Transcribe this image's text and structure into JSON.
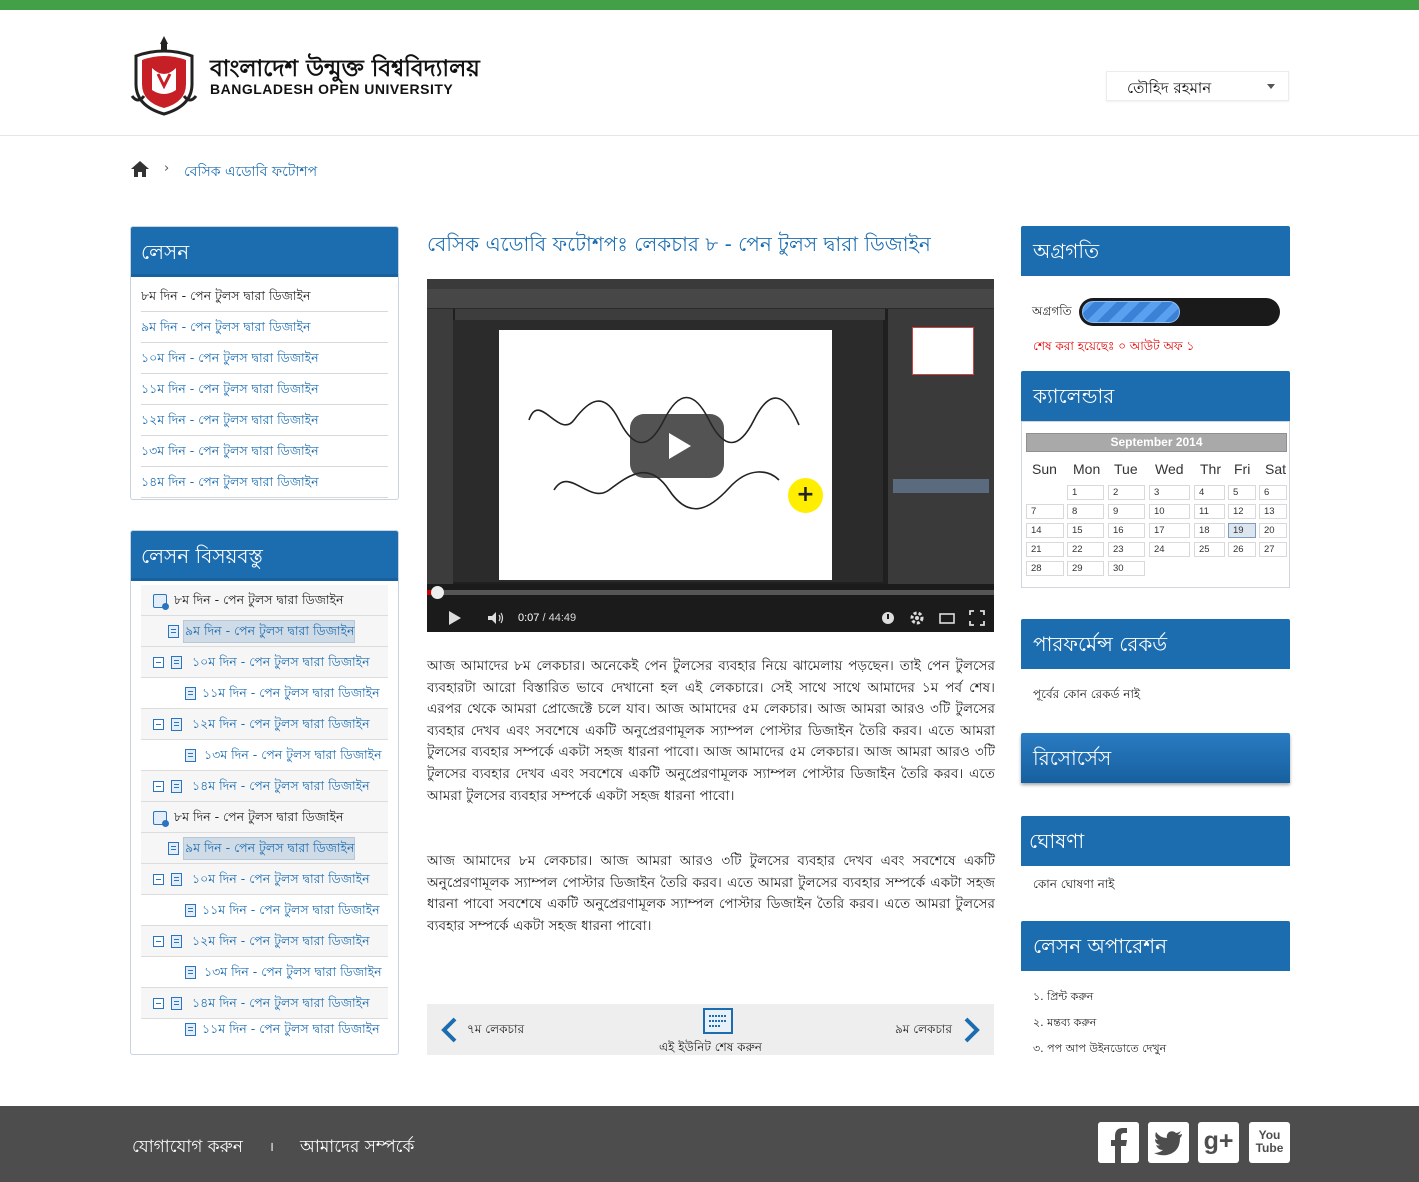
{
  "brand": {
    "name_bn": "বাংলাদেশ উন্মুক্ত বিশ্ববিদ্যালয়",
    "name_en": "BANGLADESH OPEN UNIVERSITY"
  },
  "user": {
    "name": "তৌহিদ রহমান"
  },
  "breadcrumb": {
    "current": "বেসিক এডোবি ফটোশপ"
  },
  "lesson_panel": {
    "title": "লেসন",
    "items": [
      "৮ম দিন - পেন টুলস দ্বারা ডিজাইন",
      "৯ম দিন - পেন টুলস দ্বারা ডিজাইন",
      "১০ম দিন - পেন টুলস দ্বারা ডিজাইন",
      "১১ম দিন - পেন টুলস দ্বারা ডিজাইন",
      "১২ম দিন - পেন টুলস দ্বারা ডিজাইন",
      "১৩ম দিন - পেন টুলস দ্বারা ডিজাইন",
      "১৪ম দিন - পেন টুলস দ্বারা ডিজাইন"
    ]
  },
  "content_panel": {
    "title": "লেসন বিসয়বস্তু",
    "tree": [
      "৮ম দিন - পেন টুলস দ্বারা ডিজাইন",
      "৯ম দিন - পেন টুলস দ্বারা ডিজাইন",
      "১০ম দিন - পেন টুলস দ্বারা ডিজাইন",
      "১১ম দিন - পেন টুলস দ্বারা ডিজাইন",
      "১২ম দিন - পেন টুলস দ্বারা ডিজাইন",
      "১৩ম দিন - পেন টুলস দ্বারা ডিজাইন",
      "১৪ম দিন - পেন টুলস দ্বারা ডিজাইন",
      "৮ম দিন - পেন টুলস দ্বারা ডিজাইন",
      "৯ম দিন - পেন টুলস দ্বারা ডিজাইন",
      "১০ম দিন - পেন টুলস দ্বারা ডিজাইন",
      "১১ম দিন - পেন টুলস দ্বারা ডিজাইন",
      "১২ম দিন - পেন টুলস দ্বারা ডিজাইন",
      "১৩ম দিন - পেন টুলস দ্বারা ডিজাইন",
      "১৪ম দিন - পেন টুলস দ্বারা ডিজাইন",
      "১১ম দিন - পেন টুলস দ্বারা ডিজাইন"
    ]
  },
  "main": {
    "title": "বেসিক এডোবি ফটোশপঃ লেকচার  ৮ - পেন টুলস দ্বারা ডিজাইন",
    "video": {
      "current_time": "0:07",
      "duration": "/ 44:49"
    },
    "paragraphs": [
      "আজ আমাদের ৮ম লেকচার। অনেকেই পেন টুলসের ব্যবহার নিয়ে ঝামেলায় পড়ছেন। তাই পেন টুলসের ব্যবহারটা আরো বিস্তারিত ভাবে দেখানো হল এই লেকচারে। সেই সাথে সাথে আমাদের ১ম পর্ব শেষ। এরপর থেকে আমরা প্রোজেক্টে চলে যাব। আজ আমাদের ৫ম লেকচার। আজ আমরা আরও ৩টি টুলসের ব্যবহার দেখব এবং সবশেষে একটি অনুপ্রেরণামূলক স্যাম্পল পোস্টার ডিজাইন তৈরি করব। এতে আমরা টুলসের ব্যবহার সম্পর্কে একটা সহজ ধারনা পাবো। আজ আমাদের ৫ম লেকচার। আজ আমরা আরও ৩টি টুলসের ব্যবহার দেখব এবং সবশেষে একটি অনুপ্রেরণামূলক স্যাম্পল পোস্টার ডিজাইন তৈরি করব। এতে আমরা টুলসের ব্যবহার সম্পর্কে একটা সহজ ধারনা পাবো।",
      "আজ আমাদের ৮ম লেকচার। আজ আমরা আরও ৩টি টুলসের ব্যবহার দেখব এবং সবশেষে একটি অনুপ্রেরণামূলক স্যাম্পল পোস্টার ডিজাইন তৈরি করব। এতে আমরা টুলসের ব্যবহার সম্পর্কে একটা সহজ ধারনা পাবো সবশেষে একটি অনুপ্রেরণামূলক স্যাম্পল পোস্টার ডিজাইন তৈরি করব। এতে আমরা টুলসের ব্যবহার সম্পর্কে একটা সহজ ধারনা পাবো।"
    ],
    "pager": {
      "prev": "৭ম লেকচার",
      "next": "৯ম লেকচার",
      "finish": "এই ইউনিট শেষ করুন"
    }
  },
  "progress_panel": {
    "title": "অগ্রগতি",
    "label": "অগ্রগতি",
    "fraction": 0.5,
    "done_text": "শেষ করা হয়েছেঃ ০ আউট অফ ১"
  },
  "calendar": {
    "title": "ক্যালেন্ডার",
    "month": "September 2014",
    "weekdays": [
      "Sun",
      "Mon",
      "Tue",
      "Wed",
      "Thr",
      "Fri",
      "Sat"
    ],
    "today": "19",
    "weeks": [
      [
        "",
        "1",
        "2",
        "3",
        "4",
        "5",
        "6"
      ],
      [
        "7",
        "8",
        "9",
        "10",
        "11",
        "12",
        "13"
      ],
      [
        "14",
        "15",
        "16",
        "17",
        "18",
        "19",
        "20"
      ],
      [
        "21",
        "22",
        "23",
        "24",
        "25",
        "26",
        "27"
      ],
      [
        "28",
        "29",
        "30",
        "",
        "",
        "",
        ""
      ]
    ]
  },
  "performance": {
    "title": "পারফর্মেন্স রেকর্ড",
    "text": "পূর্বের কোন রেকর্ড নাই"
  },
  "resources": {
    "title": "রিসোর্সেস"
  },
  "announcement": {
    "title": "ঘোষণা",
    "text": "কোন ঘোষণা নাই"
  },
  "operations": {
    "title": "লেসন অপারেশন",
    "items": [
      "১. প্রিন্ট করুন",
      "২. মন্তব্য করুন",
      "৩. পপ আপ উইনডোতে দেখুন"
    ]
  },
  "footer": {
    "contact": "যোগাযোগ করুন",
    "separator": "।",
    "about": "আমাদের সম্পর্কে",
    "youtube_label": "You Tube",
    "google_label": "g+"
  },
  "colors": {
    "top_bar": "#43a047",
    "panel_header": "#1c6db0",
    "link": "#1c6db0",
    "footer_bg": "#4d4d4d",
    "done_text": "#e00000"
  }
}
